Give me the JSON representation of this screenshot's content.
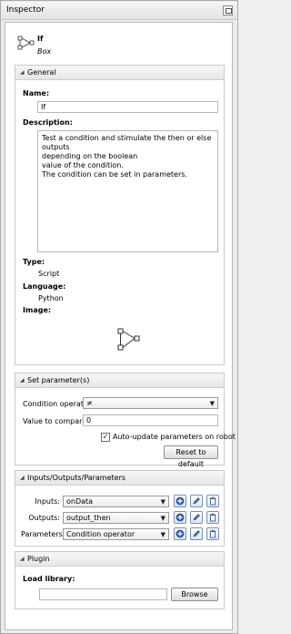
{
  "window": {
    "title": "Inspector"
  },
  "box": {
    "name": "If",
    "type": "Box"
  },
  "general": {
    "header": "General",
    "name_label": "Name:",
    "name_value": "If",
    "description_label": "Description:",
    "description_lines": [
      "Test a condition and stimulate the then or else outputs",
      "depending on the boolean",
      "value of the condition.",
      "The condition can be set in parameters."
    ],
    "type_label": "Type:",
    "type_value": "Script",
    "language_label": "Language:",
    "language_value": "Python",
    "image_label": "Image:"
  },
  "set_parameters": {
    "header": "Set parameter(s)",
    "condition_label": "Condition operator",
    "condition_value": "≠",
    "compare_label": "Value to compare",
    "compare_value": "0",
    "auto_update_label": "Auto-update parameters on robot",
    "auto_update_checked": true,
    "reset_button": "Reset to default"
  },
  "io": {
    "header": "Inputs/Outputs/Parameters",
    "rows": [
      {
        "label": "Inputs:",
        "value": "onData"
      },
      {
        "label": "Outputs:",
        "value": "output_then"
      },
      {
        "label": "Parameters:",
        "value": "Condition operator"
      }
    ]
  },
  "plugin": {
    "header": "Plugin",
    "load_label": "Load library:",
    "path_value": "",
    "browse_button": "Browse"
  },
  "colors": {
    "accent_blue": "#2a5db0",
    "border": "#c9c9c9"
  },
  "icons": [
    "float-icon",
    "box-diagram-icon",
    "collapse-triangle-icon",
    "add-icon",
    "edit-icon",
    "delete-icon"
  ]
}
